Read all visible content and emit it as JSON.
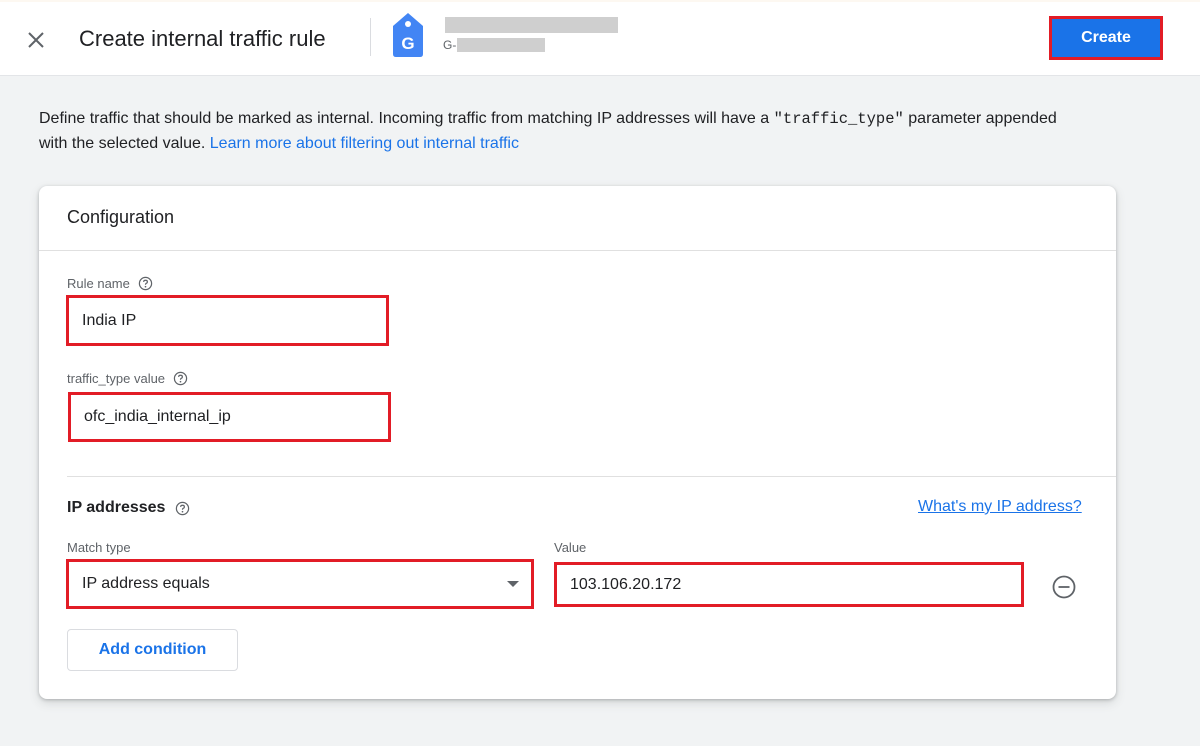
{
  "header": {
    "close_icon": "close-icon",
    "title": "Create internal traffic rule",
    "property_icon": "google-tag-icon",
    "property_icon_letter": "G",
    "property_id_prefix": "G-",
    "create_label": "Create"
  },
  "description": {
    "text_before": "Define traffic that should be marked as internal. Incoming traffic from matching IP addresses will have a ",
    "code": "\"traffic_type\"",
    "text_after": " parameter appended with the selected value. ",
    "link": "Learn more about filtering out internal traffic"
  },
  "config": {
    "title": "Configuration",
    "rule_name": {
      "label": "Rule name",
      "value": "India IP"
    },
    "traffic_type": {
      "label": "traffic_type value",
      "value": "ofc_india_internal_ip"
    },
    "ip_section": {
      "title": "IP addresses",
      "whats_my_ip": "What's my IP address?",
      "match_type_label": "Match type",
      "match_type_value": "IP address equals",
      "value_label": "Value",
      "value": "103.106.20.172",
      "add_condition": "Add condition"
    }
  },
  "colors": {
    "accent": "#1a73e8",
    "highlight": "#e21c26",
    "background": "#f1f3f4"
  }
}
